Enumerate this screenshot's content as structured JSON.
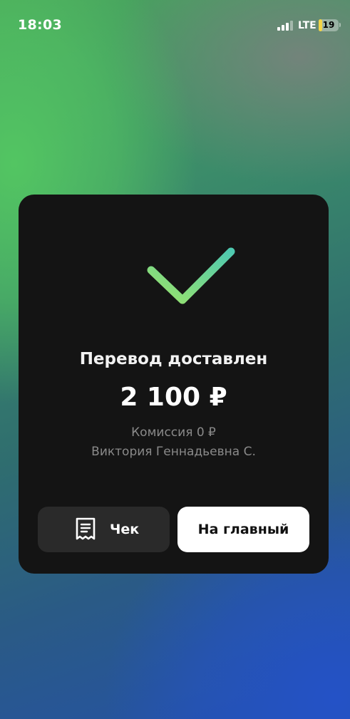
{
  "status_bar": {
    "time": "18:03",
    "network": "LTE",
    "battery": "19",
    "battery_level": 0.19,
    "battery_color": "#f3d547"
  },
  "card": {
    "icon": "checkmark-icon",
    "title": "Перевод доставлен",
    "amount": "2 100 ₽",
    "fee": "Комиссия 0 ₽",
    "recipient": "Виктория Геннадьевна С.",
    "buttons": {
      "receipt": {
        "icon": "receipt-icon",
        "label": "Чек"
      },
      "home": {
        "label": "На главный"
      }
    }
  },
  "colors": {
    "card_background": "#141414",
    "check_gradient_start": "#9be36a",
    "check_gradient_end": "#4fc9b0",
    "secondary_text": "#8a8a8a"
  }
}
